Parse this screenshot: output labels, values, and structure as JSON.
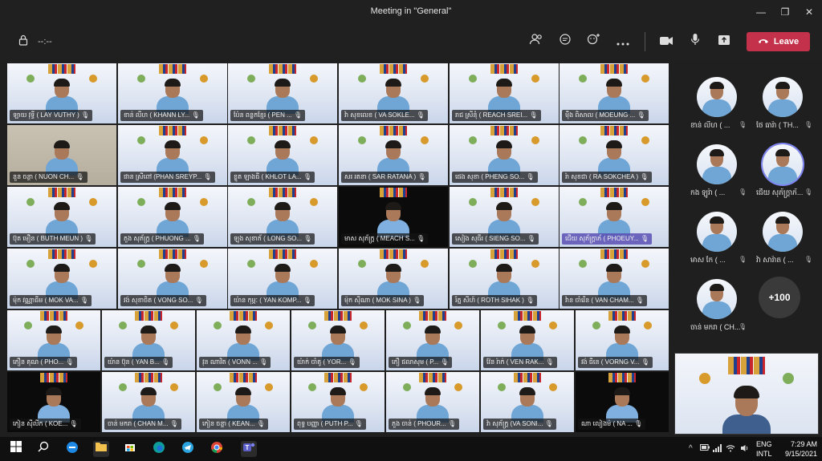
{
  "window": {
    "title": "Meeting in \"General\"",
    "minimize": "—",
    "maximize": "❐",
    "close": "✕"
  },
  "toolbar": {
    "timer": "--:--",
    "leave_label": "Leave",
    "icons": [
      "lock-icon",
      "people-icon",
      "chat-icon",
      "reactions-icon",
      "more-icon",
      "camera-icon",
      "mic-icon",
      "share-icon",
      "phone-icon"
    ]
  },
  "gallery": {
    "rows": [
      [
        {
          "name": "ឡាយ វុទ្ធី ( LAY VUTHY )",
          "variant": "light"
        },
        {
          "name": "ខាន់ លីហ ( KHANN LY...",
          "variant": "light"
        },
        {
          "name": "ប៉ែន ពន្លកខ្មែរ ( PEN ...",
          "variant": "light"
        },
        {
          "name": "វ៉ា សុខលេខ ( VA SOKLE...",
          "variant": "light"
        },
        {
          "name": "រាជ ស្រីនុំ ( REACH SREI...",
          "variant": "light"
        },
        {
          "name": "ម៉ឹង ពិសាល ( MOEUNG ...",
          "variant": "light"
        }
      ],
      [
        {
          "name": "នួន ចន្ថា ( NUON CH...",
          "variant": "room"
        },
        {
          "name": "ផាន ស្រីពៅ (PHAN SREYP...",
          "variant": "light"
        },
        {
          "name": "ខ្លូត ឡាងធី ( KHLOT LA...",
          "variant": "light"
        },
        {
          "name": "សរ រតនា ( SAR RATANA )",
          "variant": "light"
        },
        {
          "name": "ផេង សុខា ( PHENG SO...",
          "variant": "light"
        },
        {
          "name": "រ៉ា សុខជា ( RA SOKCHEA )",
          "variant": "light"
        }
      ],
      [
        {
          "name": "ប៊ុត មឿន ( BUTH MEUN )",
          "variant": "light"
        },
        {
          "name": "ភួង សុភ័ក្ត្រ ( PHUONG ...",
          "variant": "light"
        },
        {
          "name": "ឡុង សុខាភ័ ( LONG SO...",
          "variant": "light"
        },
        {
          "name": "មាស សុភ័ក្ត្រ ( MEACH S...",
          "variant": "dark"
        },
        {
          "name": "សៀង សុធីរ ( SIENG SO...",
          "variant": "light"
        },
        {
          "name": "ជើយ សុភ័ក្ត្រាភ័ ( PHOEUY...",
          "variant": "light",
          "highlight": true
        }
      ],
      [
        {
          "name": "ម៉ុក វណ្ណាធីម ( MOK VA...",
          "variant": "light"
        },
        {
          "name": "វង់ សុខាចិត ( VONG SO...",
          "variant": "light"
        },
        {
          "name": "យ៉ាន កុម្ភៈ ( YAN KOMP...",
          "variant": "light"
        },
        {
          "name": "ម៉ុក ស៊ីណា ( MOK SINA )",
          "variant": "light"
        },
        {
          "name": "រ័ត្ន សីហ៍ ( ROTH SIHAK )",
          "variant": "light"
        },
        {
          "name": "វ៉ាន ចាំរើន ( VAN CHAM...",
          "variant": "light"
        }
      ],
      [
        {
          "name": "ភឿន គុណ ( PHO...",
          "variant": "light"
        },
        {
          "name": "យ៉ាន ប៊ុន ( YAN B...",
          "variant": "light"
        },
        {
          "name": "វុន ណាវិត ( VONN ...",
          "variant": "light"
        },
        {
          "name": "យ៉ាក់ ចាំតូ ( YOR...",
          "variant": "light"
        },
        {
          "name": "ភឿ ផលាសុម ( P...",
          "variant": "light"
        },
        {
          "name": "វ៉ែន រ៉ាក់ ( VEN RAK...",
          "variant": "light"
        },
        {
          "name": "វង់ ធីនេ ( VORNG V...",
          "variant": "light"
        }
      ],
      [
        {
          "name": "កៀន ស៊ីលីក ( KOE...",
          "variant": "dark"
        },
        {
          "name": "ចាន់ មករា ( CHAN M...",
          "variant": "light"
        },
        {
          "name": "កៀន ចន្ទា ( KEAN...",
          "variant": "light"
        },
        {
          "name": "ពុទ្ធ បញ្ញា ( PUTH P...",
          "variant": "light"
        },
        {
          "name": "ភួង ចាន់ ( PHOUR...",
          "variant": "light"
        },
        {
          "name": "វ៉ា សុភ័ក្ត្រ (VA SONI...",
          "variant": "light"
        },
        {
          "name": "ណា លៀងម៉ ( NA ...",
          "variant": "dark"
        }
      ]
    ]
  },
  "side_panel": {
    "participants": [
      {
        "name": "ខាន់ លីហ ( ..."
      },
      {
        "name": "ថៃ ធារ៉ា ( TH..."
      },
      {
        "name": "កង ឡូរ៉ា ( ..."
      },
      {
        "name": "ជើយ សុភ័ក្ត្រាភ័...",
        "ring": true
      },
      {
        "name": "មាស កែ ( ..."
      },
      {
        "name": "វ៉ា សារ៉ាត ( ..."
      },
      {
        "name": "ចាន់ មករា ( CH..."
      }
    ],
    "more_count": "+100"
  },
  "taskbar": {
    "language_top": "ENG",
    "language_bottom": "INTL",
    "time": "7:29 AM",
    "date": "9/15/2021",
    "tray_chevron": "^"
  }
}
